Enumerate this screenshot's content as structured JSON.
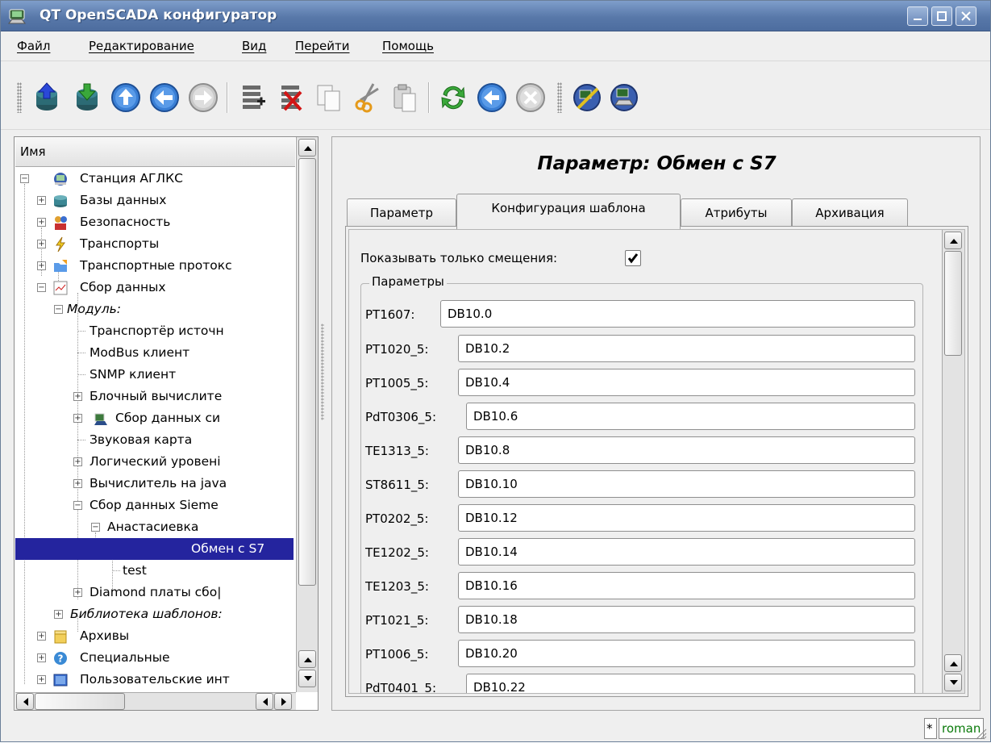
{
  "window": {
    "title": "QT OpenSCADA конфигуратор",
    "controls": [
      "minimize",
      "maximize",
      "close"
    ]
  },
  "menu": [
    {
      "label": "Файл"
    },
    {
      "label": "Редактирование"
    },
    {
      "label": "Вид"
    },
    {
      "label": "Перейти"
    },
    {
      "label": "Помощь"
    }
  ],
  "toolbar": [
    {
      "name": "db-load-icon"
    },
    {
      "name": "db-save-icon"
    },
    {
      "name": "go-up-icon"
    },
    {
      "name": "go-back-icon"
    },
    {
      "name": "go-forward-icon"
    },
    {
      "name": "add-item-icon"
    },
    {
      "name": "delete-item-icon"
    },
    {
      "name": "copy-icon"
    },
    {
      "name": "cut-icon"
    },
    {
      "name": "paste-icon"
    },
    {
      "name": "refresh-icon"
    },
    {
      "name": "start-icon"
    },
    {
      "name": "stop-icon"
    },
    {
      "name": "station-connect-icon"
    },
    {
      "name": "station-manage-icon"
    }
  ],
  "tree": {
    "header": "Имя",
    "items": [
      {
        "label": "Станция АГЛКС"
      },
      {
        "label": "Базы данных"
      },
      {
        "label": "Безопасность"
      },
      {
        "label": "Транспорты"
      },
      {
        "label": "Транспортные протокс"
      },
      {
        "label": "Сбор данных"
      },
      {
        "label": "Модуль:"
      },
      {
        "label": "Транспортёр источн"
      },
      {
        "label": "ModBus клиент"
      },
      {
        "label": "SNMP клиент"
      },
      {
        "label": "Блочный вычислите"
      },
      {
        "label": "Сбор данных си"
      },
      {
        "label": "Звуковая карта"
      },
      {
        "label": "Логический уровені"
      },
      {
        "label": "Вычислитель на java"
      },
      {
        "label": "Сбор данных Sieme"
      },
      {
        "label": "Анастасиевка"
      },
      {
        "label": "Обмен с S7"
      },
      {
        "label": "test"
      },
      {
        "label": "Diamond платы сбо|"
      },
      {
        "label": "Библиотека шаблонов:"
      },
      {
        "label": "Архивы"
      },
      {
        "label": "Специальные"
      },
      {
        "label": "Пользовательские инт"
      }
    ],
    "selected": "Обмен с S7"
  },
  "panel": {
    "title": "Параметр: Обмен с S7",
    "tabs": [
      {
        "label": "Параметр"
      },
      {
        "label": "Конфигурация шаблона"
      },
      {
        "label": "Атрибуты"
      },
      {
        "label": "Архивация"
      }
    ],
    "active_tab": "Конфигурация шаблона",
    "show_offsets_label": "Показывать только смещения:",
    "show_offsets_checked": true,
    "group_title": "Параметры",
    "params": [
      {
        "label": "PT1607:",
        "value": "DB10.0"
      },
      {
        "label": "PT1020_5:",
        "value": "DB10.2"
      },
      {
        "label": "PT1005_5:",
        "value": "DB10.4"
      },
      {
        "label": "PdT0306_5:",
        "value": "DB10.6"
      },
      {
        "label": "TE1313_5:",
        "value": "DB10.8"
      },
      {
        "label": "ST8611_5:",
        "value": "DB10.10"
      },
      {
        "label": "PT0202_5:",
        "value": "DB10.12"
      },
      {
        "label": "TE1202_5:",
        "value": "DB10.14"
      },
      {
        "label": "TE1203_5:",
        "value": "DB10.16"
      },
      {
        "label": "PT1021_5:",
        "value": "DB10.18"
      },
      {
        "label": "PT1006_5:",
        "value": "DB10.20"
      },
      {
        "label": "PdT0401_5:",
        "value": "DB10.22"
      }
    ]
  },
  "statusbar": {
    "modified": "*",
    "user": "roman",
    "user_color": "#0a7a0a"
  }
}
